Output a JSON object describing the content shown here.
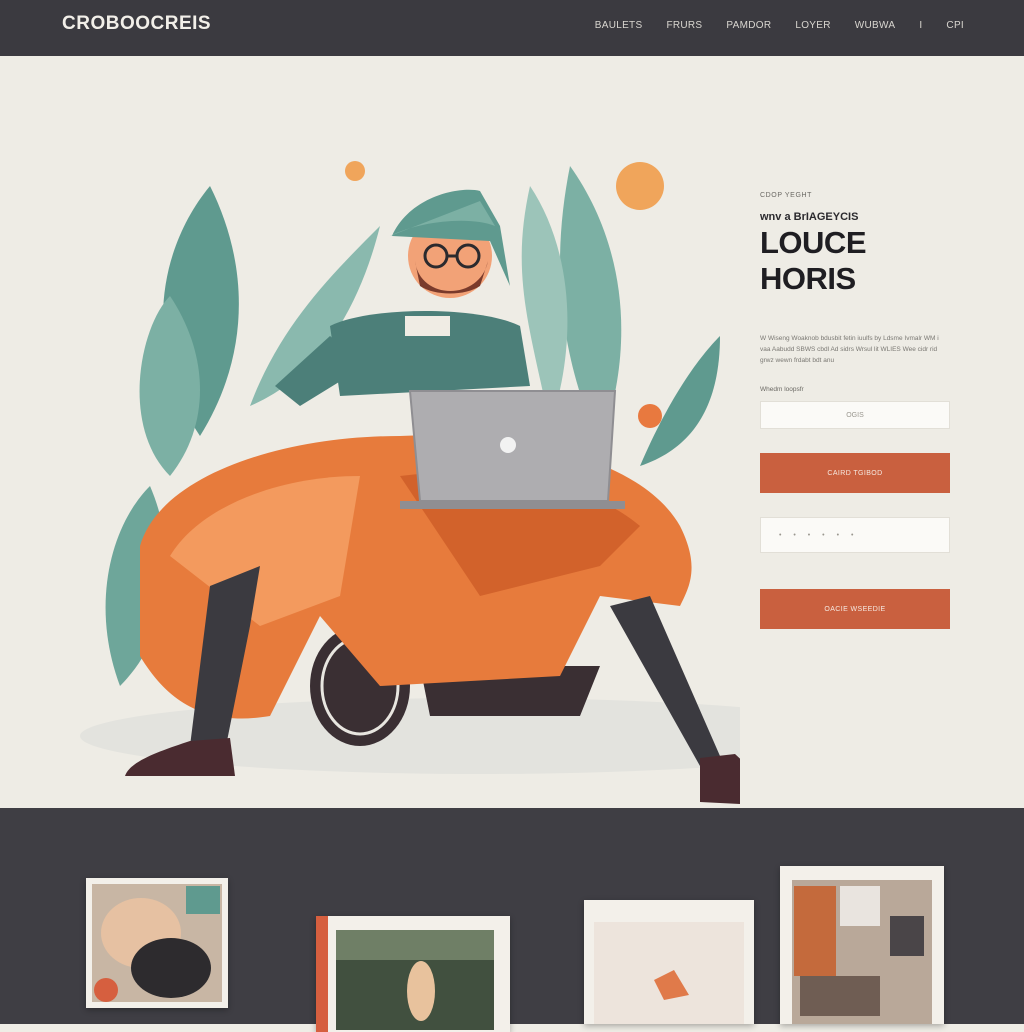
{
  "brand": {
    "name": "CROBOOCREIS",
    "logo_icon": "brand-logo"
  },
  "nav": {
    "links": [
      "BAULETS",
      "FRURS",
      "PAMDOR",
      "LOYER",
      "WUBWA",
      "I",
      "CPI"
    ]
  },
  "hero": {
    "eyebrow": "CDOP YEGHT",
    "kicker": "wnv a BrIAGEYCIS",
    "headline": "LOUCE HORIS",
    "body": "W Wiseng Woaknob bdusbit fetin iuulfs by Ldsme Ivmalr WM i vaa Aabudd SBWS cbdl Ad sidrs Wrsul lit WLIES Wee cidr rid grwz wewn frdabt bdt anu",
    "field_label": "Whedm loopsfr",
    "field1_value": "OGIS",
    "button1_label": "CAIRD TGIBOD",
    "field2_value": "• • • • • •",
    "button2_label": "OACIE WSEEDIE"
  },
  "colors": {
    "accent": "#c9603f",
    "dark": "#3b3a40",
    "background": "#eeece5"
  }
}
